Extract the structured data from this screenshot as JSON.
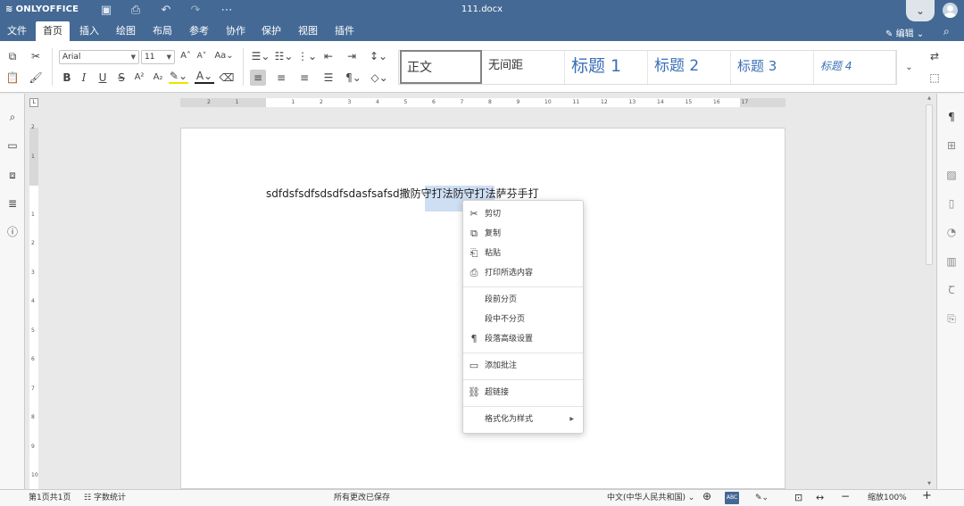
{
  "app": {
    "logo_text": "ONLYOFFICE",
    "document_title": "111.docx"
  },
  "menu": {
    "tabs": [
      "文件",
      "首页",
      "插入",
      "绘图",
      "布局",
      "参考",
      "协作",
      "保护",
      "视图",
      "插件"
    ],
    "active_tab": "首页",
    "edit_mode_label": "编辑"
  },
  "toolbar": {
    "font_name": "Arial",
    "font_size": "11",
    "styles": [
      "正文",
      "无间距",
      "标题 1",
      "标题 2",
      "标题 3",
      "标题 4"
    ],
    "selected_style": "正文"
  },
  "document": {
    "text_before": "sdfdsfsdfsdsdfsdasfsafsd撒防守",
    "text_selected": "打法防守",
    "text_after": "打法萨芬手打"
  },
  "context_menu": {
    "items": {
      "cut": "剪切",
      "copy": "复制",
      "paste": "粘贴",
      "print_selection": "打印所选内容",
      "page_break_before": "段前分页",
      "keep_lines_together": "段中不分页",
      "paragraph_advanced": "段落高级设置",
      "add_comment": "添加批注",
      "hyperlink": "超链接",
      "format_as_style": "格式化为样式"
    }
  },
  "statusbar": {
    "page_info": "第1页共1页",
    "word_count": "字数统计",
    "save_status": "所有更改已保存",
    "language": "中文(中华人民共和国)",
    "zoom": "缩放100%"
  },
  "colors": {
    "header_blue": "#446995",
    "selection": "#74a0dc",
    "heading_blue": "#3a6fb7"
  }
}
